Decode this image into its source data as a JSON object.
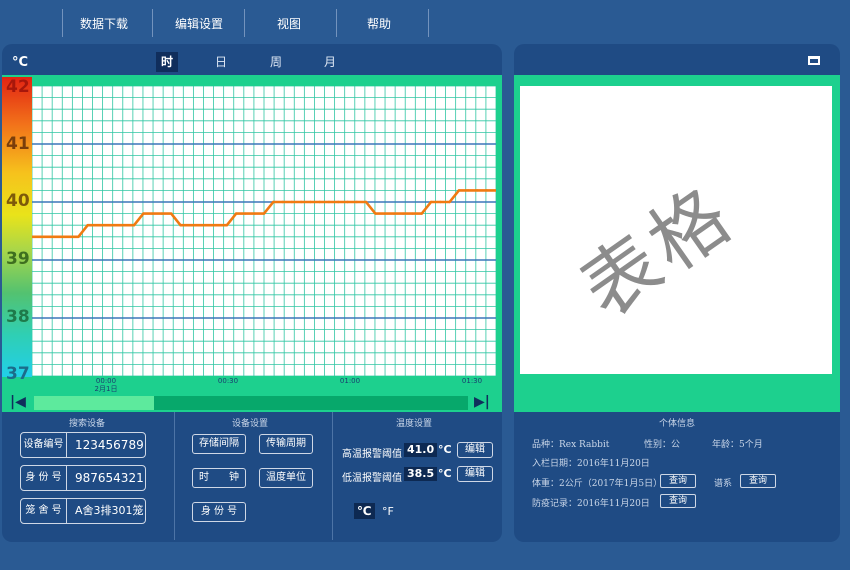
{
  "menu": [
    "数据下载",
    "编辑设置",
    "视图",
    "帮助"
  ],
  "chart": {
    "unit": "°C",
    "tabs": [
      "时",
      "日",
      "周",
      "月"
    ],
    "active_tab": 0,
    "scale_labels": [
      "42",
      "41",
      "40",
      "39",
      "38",
      "37"
    ],
    "time_labels": [
      "00:00",
      "00:30",
      "01:00",
      "01:30"
    ],
    "date_label": "2月1日",
    "colors": {
      "line": "#f07a12",
      "grid": "#30c6a4",
      "major_grid": "#3a76b9"
    }
  },
  "chart_data": {
    "type": "line",
    "x_label_ticks": [
      "00:00",
      "00:30",
      "01:00",
      "01:30"
    ],
    "ylim": [
      37,
      42
    ],
    "series": [
      {
        "values": [
          39.4,
          39.4,
          39.4,
          39.4,
          39.4,
          39.4,
          39.6,
          39.6,
          39.6,
          39.6,
          39.6,
          39.6,
          39.8,
          39.8,
          39.8,
          39.8,
          39.6,
          39.6,
          39.6,
          39.6,
          39.6,
          39.6,
          39.8,
          39.8,
          39.8,
          39.8,
          40.0,
          40.0,
          40.0,
          40.0,
          40.0,
          40.0,
          40.0,
          40.0,
          40.0,
          40.0,
          40.0,
          39.8,
          39.8,
          39.8,
          39.8,
          39.8,
          39.8,
          40.0,
          40.0,
          40.0,
          40.2,
          40.2,
          40.2,
          40.2,
          40.2
        ]
      }
    ]
  },
  "table": {
    "watermark": "表格"
  },
  "search": {
    "title": "搜索设备",
    "device_label": "设备编号",
    "device_value": "123456789",
    "id_label": "身 份 号",
    "id_value": "987654321",
    "cage_label": "笼 舍 号",
    "cage_value": "A舍3排301笼"
  },
  "device_settings": {
    "title": "设备设置",
    "storage_interval": "存储间隔",
    "transmit_period": "传输周期",
    "clock": "时　　钟",
    "temp_unit": "温度单位",
    "id_number": "身 份 号"
  },
  "temp_settings": {
    "title": "温度设置",
    "high_label": "高温报警阈值",
    "high_value": "41.0",
    "low_label": "低温报警阈值",
    "low_value": "38.5",
    "unit_c": "°C",
    "edit": "编辑",
    "toggle_c": "℃",
    "toggle_f": "°F"
  },
  "individual": {
    "title": "个体信息",
    "breed": "品种：Rex Rabbit",
    "sex": "性别：公",
    "age": "年龄：5个月",
    "entry_date": "入栏日期：2016年11月20日",
    "weight": "体重：2公斤（2017年1月5日）",
    "pedigree": "谱系",
    "vaccine": "防疫记录：2016年11月20日",
    "query": "查询"
  }
}
